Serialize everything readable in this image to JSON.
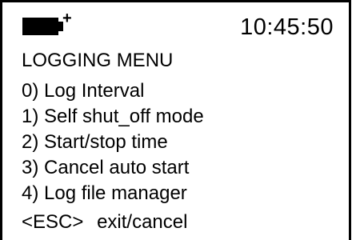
{
  "status": {
    "battery_icon": "battery-charging-icon",
    "time": "10:45:50"
  },
  "menu": {
    "title": "LOGGING MENU",
    "items": [
      {
        "label": "0) Log Interval"
      },
      {
        "label": "1) Self shut_off mode"
      },
      {
        "label": "2) Start/stop time"
      },
      {
        "label": "3) Cancel auto start"
      },
      {
        "label": "4) Log file manager"
      }
    ]
  },
  "footer": {
    "key": "<ESC>",
    "action": "exit/cancel"
  },
  "colors": {
    "background": "#ffffff",
    "foreground": "#000000"
  }
}
